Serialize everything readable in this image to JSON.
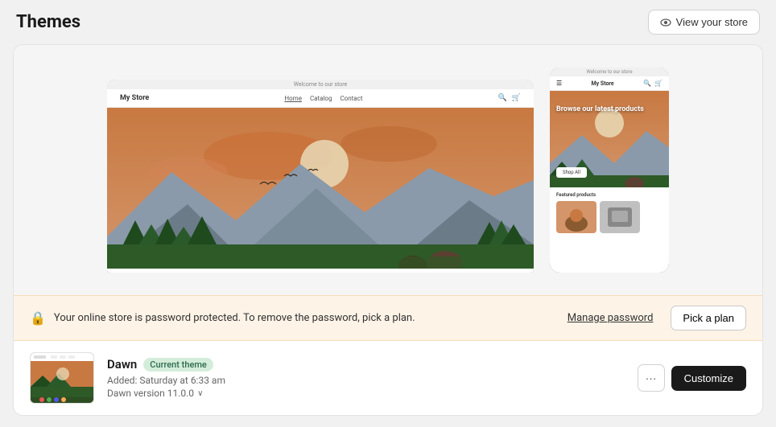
{
  "header": {
    "title": "Themes",
    "view_store_label": "View your store"
  },
  "preview": {
    "desktop_url": "Welcome to our store",
    "desktop_nav_logo": "My Store",
    "desktop_nav_links": [
      "Home",
      "Catalog",
      "Contact"
    ],
    "mobile_url": "Welcome to our store",
    "mobile_nav_logo": "My Store",
    "mobile_hero_text": "Browse our latest products",
    "mobile_shop_btn": "Shop All",
    "mobile_featured_title": "Featured products"
  },
  "password_banner": {
    "text": "Your online store is password protected. To remove the password, pick a plan.",
    "manage_password_label": "Manage password",
    "pick_plan_label": "Pick a plan"
  },
  "theme": {
    "name": "Dawn",
    "badge": "Current theme",
    "added": "Added: Saturday at 6:33 am",
    "version": "Dawn version 11.0.0",
    "more_icon": "···",
    "customize_label": "Customize"
  },
  "colors": {
    "accent_green": "#2d6a4f",
    "badge_bg": "#d4edda",
    "banner_bg": "#fdf3e7"
  }
}
